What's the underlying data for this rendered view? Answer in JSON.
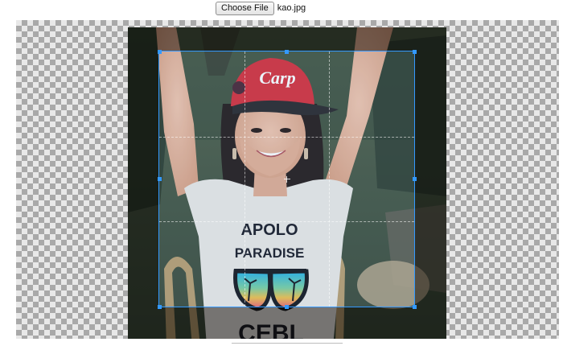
{
  "file_input": {
    "button_label": "Choose File",
    "file_name": "kao.jpg"
  },
  "cropper": {
    "image_subject": "Woman in red Carp cap and white graphic t-shirt with raised arms",
    "cap_text": "Carp",
    "shirt_text_line1": "APOLO",
    "shirt_text_line2": "PARADISE",
    "shirt_text_line3": "CEBL"
  },
  "colors": {
    "crop_outline": "#3399ff",
    "checker_dark": "#a9a9a9",
    "checker_light": "#e8e8e8"
  }
}
